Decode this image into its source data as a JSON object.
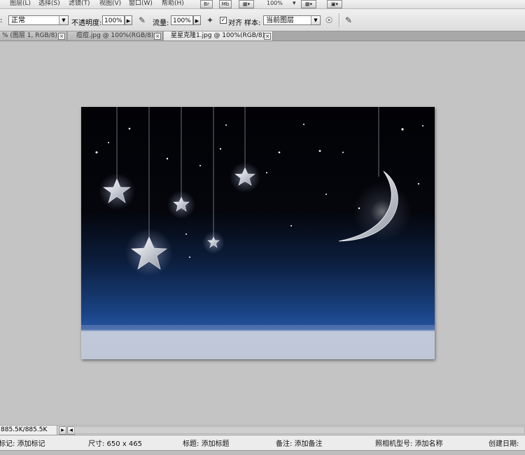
{
  "menu": {
    "items": [
      "图层(L)",
      "选择(S)",
      "滤镜(T)",
      "视图(V)",
      "窗口(W)",
      "帮助(H)"
    ],
    "buttons": [
      "Br",
      "Mb"
    ],
    "zoom": "100%"
  },
  "options": {
    "mode_value": "正常",
    "opacity_label": "不透明度:",
    "opacity_value": "100%",
    "flow_label": "流量:",
    "flow_value": "100%",
    "align_label": "对齐",
    "sample_label": "样本:",
    "sample_value": "当前图层"
  },
  "tabs": [
    {
      "label": "% (图层 1, RGB/8) *"
    },
    {
      "label": "痘痘.jpg @ 100%(RGB/8) *"
    },
    {
      "label": "星星克隆1.jpg @ 100%(RGB/8)"
    }
  ],
  "status": {
    "doc_size": "885.5K/885.5K",
    "mark": "标记: 添加标记",
    "size": "尺寸: 650 x 465",
    "title": "标题: 添加标题",
    "note": "备注: 添加备注",
    "camera": "照相机型号: 添加名称",
    "created": "创建日期:"
  },
  "colors": {
    "sky_top": "#020206",
    "sky_bottom": "#1f4f96",
    "ground": "#c0c9da"
  }
}
